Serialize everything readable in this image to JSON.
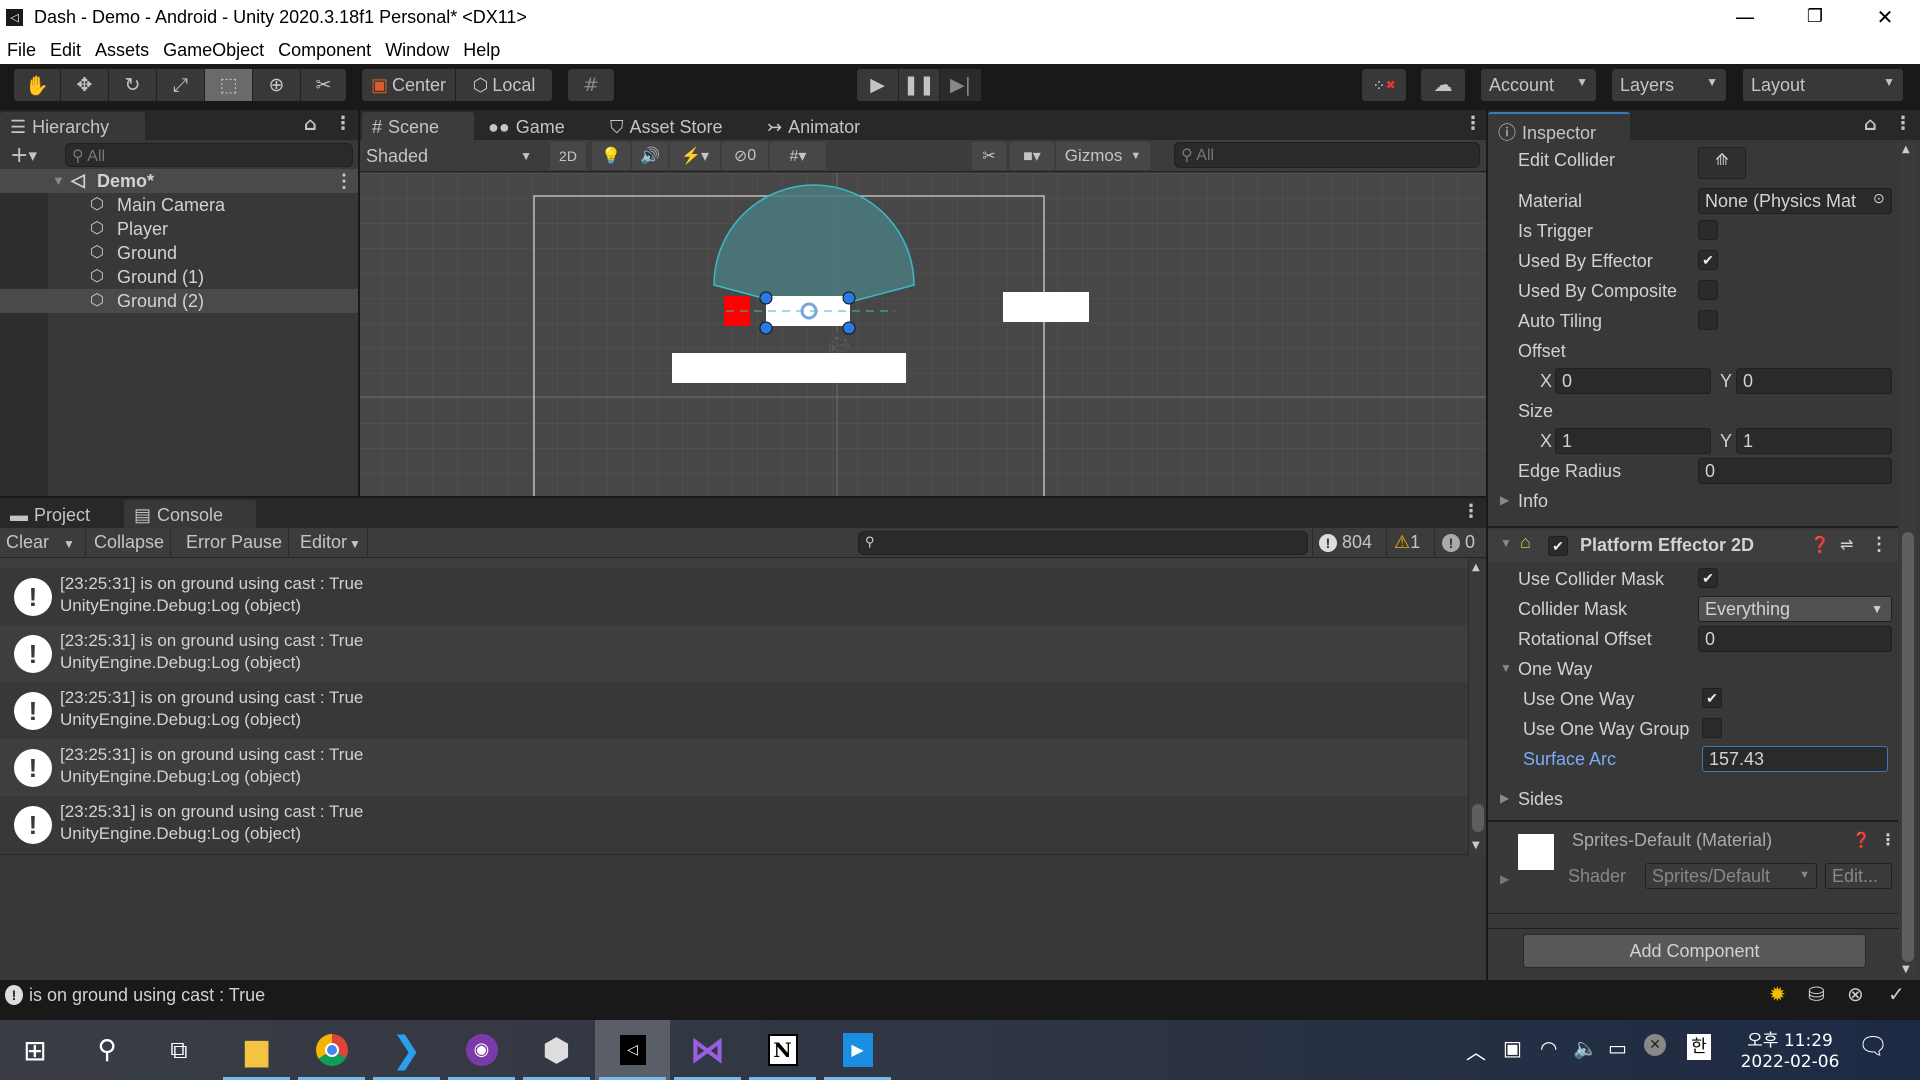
{
  "window": {
    "title": "Dash - Demo - Android - Unity 2020.3.18f1 Personal* <DX11>",
    "controls": {
      "minimize": "—",
      "maximize": "❐",
      "close": "✕"
    }
  },
  "menu": [
    "File",
    "Edit",
    "Assets",
    "GameObject",
    "Component",
    "Window",
    "Help"
  ],
  "toolbar": {
    "tools": [
      "hand-tool",
      "move-tool",
      "rotate-tool",
      "scale-tool",
      "rect-tool",
      "transform-tool",
      "custom-tool"
    ],
    "active_tool": "rect-tool",
    "pivot_label": "Center",
    "space_label": "Local",
    "account_label": "Account",
    "layers_label": "Layers",
    "layout_label": "Layout"
  },
  "hierarchy": {
    "tab_label": "Hierarchy",
    "search_placeholder": "All",
    "scene_name": "Demo*",
    "items": [
      "Main Camera",
      "Player",
      "Ground",
      "Ground (1)",
      "Ground (2)"
    ],
    "selected_index": 4
  },
  "scene": {
    "tabs": [
      "Scene",
      "Game",
      "Asset Store",
      "Animator"
    ],
    "active_tab": "Scene",
    "shading_mode": "Shaded",
    "mode_2d_label": "2D",
    "hidden_count": "0",
    "gizmos_label": "Gizmos",
    "search_placeholder": "All",
    "colors": {
      "arc": "#3bbac9",
      "player": "#ff0000",
      "handle": "#2a7ae6"
    }
  },
  "console": {
    "tabs": [
      "Project",
      "Console"
    ],
    "active_tab": "Console",
    "clear_label": "Clear",
    "collapse_label": "Collapse",
    "error_pause_label": "Error Pause",
    "editor_label": "Editor",
    "search_value": "",
    "log_count": "804",
    "warning_count": "1",
    "error_count": "0",
    "entries": [
      {
        "line1": "[23:25:31] is on ground using cast : True",
        "line2": "UnityEngine.Debug:Log (object)"
      },
      {
        "line1": "[23:25:31] is on ground using cast : True",
        "line2": "UnityEngine.Debug:Log (object)"
      },
      {
        "line1": "[23:25:31] is on ground using cast : True",
        "line2": "UnityEngine.Debug:Log (object)"
      },
      {
        "line1": "[23:25:31] is on ground using cast : True",
        "line2": "UnityEngine.Debug:Log (object)"
      },
      {
        "line1": "[23:25:31] is on ground using cast : True",
        "line2": "UnityEngine.Debug:Log (object)"
      }
    ]
  },
  "inspector": {
    "tab_label": "Inspector",
    "collider": {
      "edit_collider_label": "Edit Collider",
      "material_label": "Material",
      "material_value": "None (Physics Mat",
      "is_trigger_label": "Is Trigger",
      "is_trigger": false,
      "used_by_effector_label": "Used By Effector",
      "used_by_effector": true,
      "used_by_composite_label": "Used By Composite",
      "used_by_composite": false,
      "auto_tiling_label": "Auto Tiling",
      "auto_tiling": false,
      "offset_label": "Offset",
      "offset_x": "0",
      "offset_y": "0",
      "size_label": "Size",
      "size_x": "1",
      "size_y": "1",
      "edge_radius_label": "Edge Radius",
      "edge_radius": "0",
      "info_label": "Info",
      "x_label": "X",
      "y_label": "Y"
    },
    "effector": {
      "title": "Platform Effector 2D",
      "enabled": true,
      "use_collider_mask_label": "Use Collider Mask",
      "use_collider_mask": true,
      "collider_mask_label": "Collider Mask",
      "collider_mask_value": "Everything",
      "rotational_offset_label": "Rotational Offset",
      "rotational_offset": "0",
      "one_way_label": "One Way",
      "use_one_way_label": "Use One Way",
      "use_one_way": true,
      "use_one_way_group_label": "Use One Way Group",
      "use_one_way_group": false,
      "surface_arc_label": "Surface Arc",
      "surface_arc": "157.43",
      "sides_label": "Sides"
    },
    "material": {
      "title": "Sprites-Default (Material)",
      "shader_label": "Shader",
      "shader_value": "Sprites/Default",
      "edit_label": "Edit..."
    },
    "add_component_label": "Add Component"
  },
  "statusbar": {
    "message": "is on ground using cast : True"
  },
  "taskbar": {
    "apps": [
      "start",
      "search",
      "task-view",
      "file-explorer",
      "chrome",
      "vscode",
      "github-desktop",
      "unity-hub",
      "unity",
      "visual-studio",
      "notion",
      "media-player"
    ],
    "active_app": "unity",
    "time": "오후 11:29",
    "date": "2022-02-06",
    "ime": "한"
  }
}
